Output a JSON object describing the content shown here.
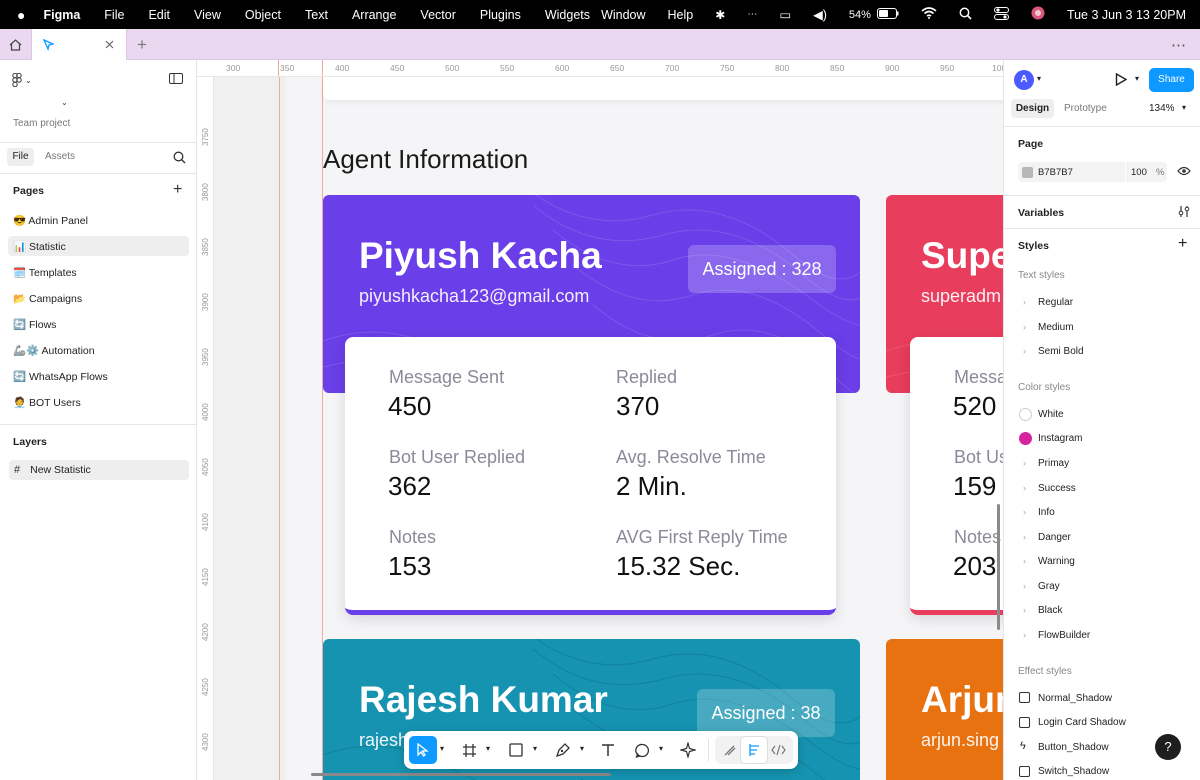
{
  "menubar": {
    "app": "Figma",
    "items": [
      "File",
      "Edit",
      "View",
      "Object",
      "Text",
      "Arrange",
      "Vector",
      "Plugins",
      "Widgets"
    ],
    "right_items": [
      "Window",
      "Help"
    ],
    "battery": "54%",
    "clock": "Tue 3 Jun  3 13 20PM"
  },
  "left_panel": {
    "project": "Team project",
    "tab_file": "File",
    "tab_assets": "Assets",
    "pages_title": "Pages",
    "pages": [
      {
        "label": "😎 Admin Panel"
      },
      {
        "label": "📊 Statistic"
      },
      {
        "label": "🗓️ Templates"
      },
      {
        "label": "📂 Campaigns"
      },
      {
        "label": "🔄 Flows"
      },
      {
        "label": "🦾⚙️ Automation"
      },
      {
        "label": "🔄 WhatsApp Flows"
      },
      {
        "label": "🧑‍💼 BOT Users"
      }
    ],
    "layers_title": "Layers",
    "layer": "New Statistic"
  },
  "ruler": {
    "top": [
      "300",
      "350",
      "400",
      "450",
      "500",
      "550",
      "600",
      "650",
      "700",
      "750",
      "800",
      "850",
      "900",
      "950",
      "100"
    ],
    "left": [
      "3750",
      "3800",
      "3850",
      "3900",
      "3950",
      "4000",
      "4050",
      "4100",
      "4150",
      "4200",
      "4250",
      "4300"
    ]
  },
  "canvas": {
    "section_title": "Agent Information",
    "agents": [
      {
        "name": "Piyush Kacha",
        "email": "piyushkacha123@gmail.com",
        "assigned": "Assigned : 328",
        "color": "#6a3ee8",
        "stats": [
          {
            "label": "Message Sent",
            "value": "450"
          },
          {
            "label": "Replied",
            "value": "370"
          },
          {
            "label": "Bot User Replied",
            "value": "362"
          },
          {
            "label": "Avg. Resolve Time",
            "value": "2 Min."
          },
          {
            "label": "Notes",
            "value": "153"
          },
          {
            "label": "AVG First Reply Time",
            "value": "15.32 Sec."
          }
        ]
      },
      {
        "name": "Supe",
        "email": "superadm",
        "color": "#e83d5c",
        "stats": [
          {
            "label": "Messa",
            "value": "520"
          },
          {
            "label": "Bot Us",
            "value": "159"
          },
          {
            "label": "Notes",
            "value": "203"
          }
        ]
      },
      {
        "name": "Rajesh Kumar",
        "email": "rajesh",
        "assigned": "Assigned : 38",
        "color": "#1593b0"
      },
      {
        "name": "Arjun",
        "email": "arjun.sing",
        "color": "#e8720f"
      }
    ]
  },
  "right_panel": {
    "share": "Share",
    "tab_design": "Design",
    "tab_prototype": "Prototype",
    "zoom": "134%",
    "page_title": "Page",
    "page_color": "B7B7B7",
    "page_opacity": "100",
    "percent": "%",
    "variables": "Variables",
    "styles": "Styles",
    "text_styles": "Text styles",
    "text_items": [
      "Regular",
      "Medium",
      "Semi Bold"
    ],
    "color_styles": "Color styles",
    "color_items": [
      {
        "label": "White",
        "swatch": "#ffffff"
      },
      {
        "label": "Instagram",
        "swatch": "#d6249f"
      },
      {
        "label": "Primay"
      },
      {
        "label": "Success"
      },
      {
        "label": "Info"
      },
      {
        "label": "Danger"
      },
      {
        "label": "Warning"
      },
      {
        "label": "Gray"
      },
      {
        "label": "Black"
      },
      {
        "label": "FlowBuilder"
      }
    ],
    "effect_styles": "Effect styles",
    "effect_items": [
      "Normal_Shadow",
      "Login Card Shadow",
      "Button_Shadow",
      "Switch_Shadow"
    ],
    "help": "?"
  },
  "colors": {
    "accent": "#0d99ff",
    "tabbar": "#e9d8f0",
    "canvas": "#f0f0f0"
  }
}
